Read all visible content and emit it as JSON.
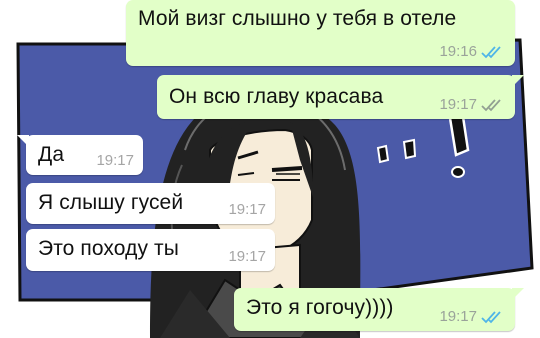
{
  "colors": {
    "outgoing_bubble": "#e2ffc8",
    "incoming_bubble": "#ffffff",
    "read_ticks": "#4fb5e8",
    "delivered_ticks": "#92a092",
    "wallpaper_blue": "#4b5aa8",
    "wallpaper_white": "#ffffff"
  },
  "messages": [
    {
      "direction": "outgoing",
      "text": "Мой визг слышно у тебя в отеле",
      "time": "19:16",
      "status": "read",
      "status_icon": "double-check-blue-icon"
    },
    {
      "direction": "outgoing",
      "text": "Он всю главу красава",
      "time": "19:17",
      "status": "delivered",
      "status_icon": "double-check-grey-icon"
    },
    {
      "direction": "incoming",
      "text": "Да",
      "time": "19:17"
    },
    {
      "direction": "incoming",
      "text": "Я слышу гусей",
      "time": "19:17"
    },
    {
      "direction": "incoming",
      "text": "Это походу ты",
      "time": "19:17"
    },
    {
      "direction": "outgoing",
      "text": "Это я гогочу))))",
      "time": "19:17",
      "status": "read",
      "status_icon": "double-check-blue-icon"
    }
  ]
}
